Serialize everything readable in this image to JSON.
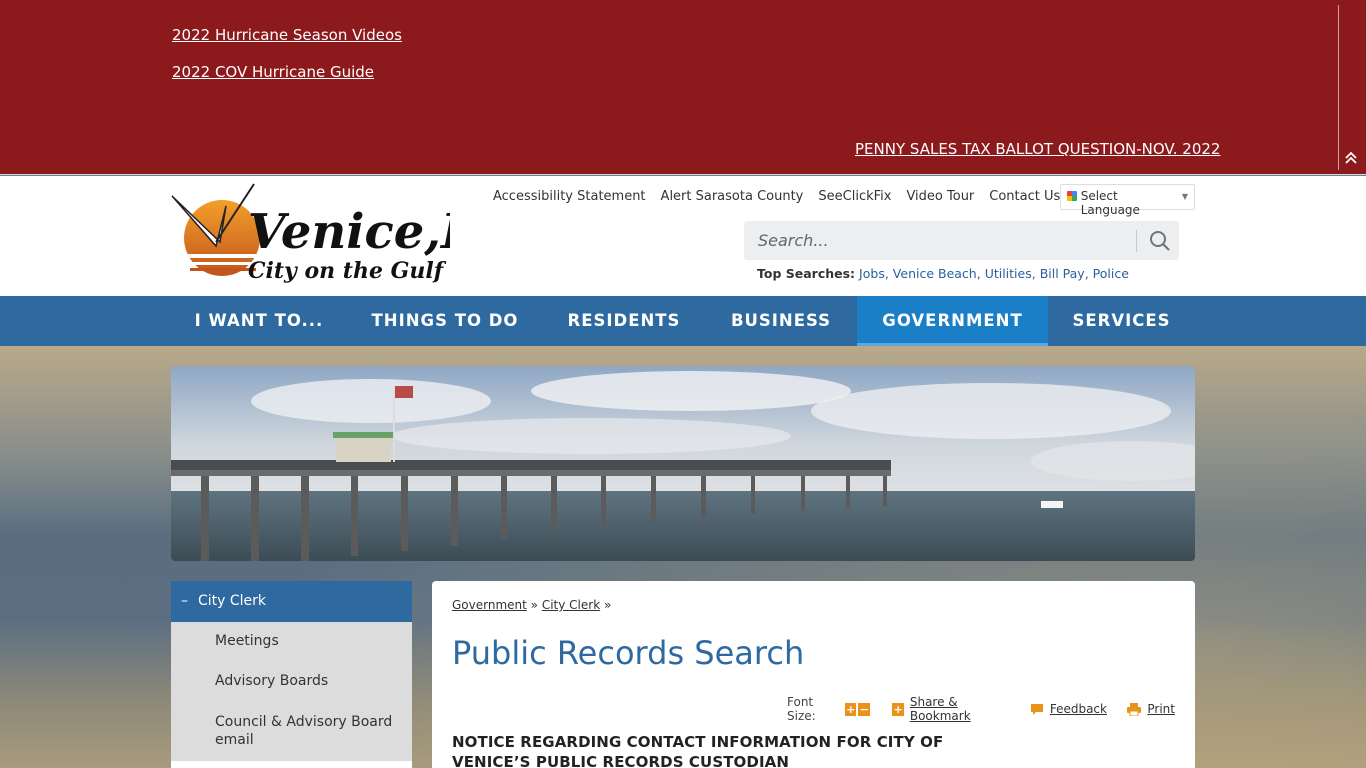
{
  "alert": {
    "links": [
      "2022 Hurricane Season Videos",
      "2022 COV Hurricane Guide"
    ],
    "featured_link": "PENNY SALES TAX BALLOT QUESTION-NOV. 2022"
  },
  "header": {
    "logo_text": "Venice,FL",
    "logo_tagline": "City on the Gulf",
    "utility_links": [
      "Accessibility Statement",
      "Alert Sarasota County",
      "SeeClickFix",
      "Video Tour",
      "Contact Us"
    ],
    "language_label": "Select Language",
    "search_placeholder": "Search...",
    "top_searches_label": "Top Searches:",
    "top_searches": [
      "Jobs,",
      "Venice Beach,",
      "Utilities,",
      "Bill Pay,",
      "Police"
    ]
  },
  "nav": {
    "items": [
      "I WANT TO...",
      "THINGS TO DO",
      "RESIDENTS",
      "BUSINESS",
      "GOVERNMENT",
      "SERVICES"
    ],
    "active": "GOVERNMENT"
  },
  "sidebar": {
    "heading": "City Clerk",
    "items": [
      "Meetings",
      "Advisory Boards",
      "Council & Advisory Board email"
    ]
  },
  "content": {
    "breadcrumb": [
      "Government",
      "City Clerk"
    ],
    "breadcrumb_sep": "»",
    "title": "Public Records Search",
    "font_size_label": "Font Size:",
    "share_label": "Share & Bookmark",
    "feedback_label": "Feedback",
    "print_label": "Print",
    "notice": "NOTICE REGARDING CONTACT INFORMATION FOR CITY OF VENICE’S PUBLIC RECORDS CUSTODIAN"
  },
  "colors": {
    "alert_bg": "#8c1a1c",
    "nav_bg": "#2e6aa0",
    "nav_active": "#1b7fc8",
    "title": "#2e6aa0",
    "tool_orange": "#e9931b"
  }
}
